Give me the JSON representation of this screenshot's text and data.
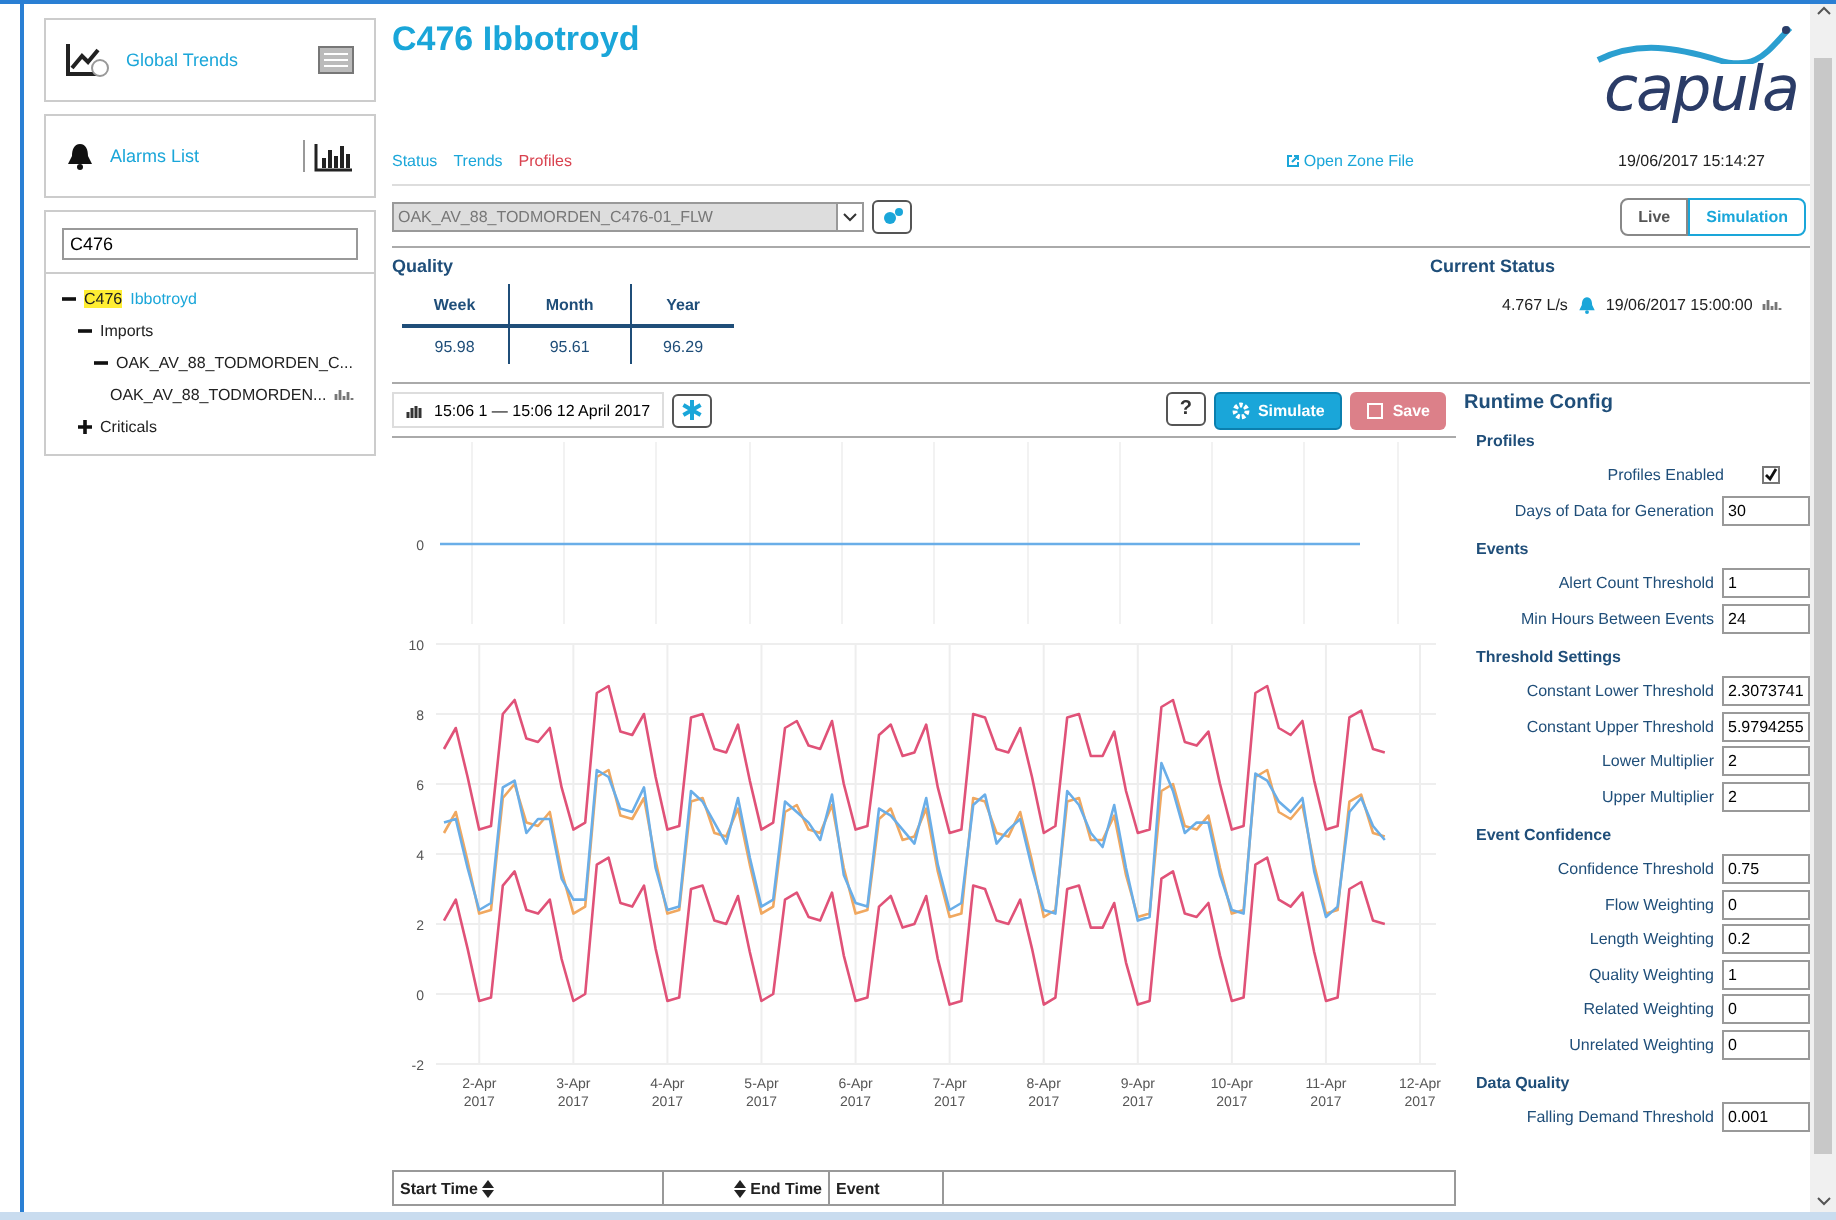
{
  "sidebar": {
    "cards": [
      {
        "kind": "trends",
        "label": "Global Trends"
      },
      {
        "kind": "alarms",
        "label": "Alarms List"
      }
    ],
    "search": {
      "value": "C476"
    },
    "tree": [
      {
        "kind": "site",
        "match": "C476",
        "label": "Ibbotroyd",
        "expanded": true,
        "children": [
          {
            "kind": "group",
            "label": "Imports",
            "expanded": true,
            "children": [
              {
                "kind": "group",
                "label": "OAK_AV_88_TODMORDEN_C...",
                "expanded": true,
                "children": [
                  {
                    "kind": "leaf",
                    "label": "OAK_AV_88_TODMORDEN..."
                  }
                ]
              }
            ]
          },
          {
            "kind": "group",
            "label": "Criticals",
            "expanded": false
          }
        ]
      }
    ]
  },
  "header": {
    "title": "C476 Ibbotroyd",
    "logo": "capula"
  },
  "nav": [
    {
      "label": "Status",
      "selected": false
    },
    {
      "label": "Trends",
      "selected": false
    },
    {
      "label": "Profiles",
      "selected": true
    }
  ],
  "open_zone_file": "Open Zone File",
  "timestamp": "19/06/2017 15:14:27",
  "meter_select": {
    "value": "OAK_AV_88_TODMORDEN_C476-01_FLW"
  },
  "mode": [
    {
      "label": "Live",
      "selected": false
    },
    {
      "label": "Simulation",
      "selected": true
    }
  ],
  "quality": {
    "title": "Quality",
    "columns": [
      "Week",
      "Month",
      "Year"
    ],
    "values": [
      "95.98",
      "95.61",
      "96.29"
    ]
  },
  "current_status": {
    "title": "Current Status",
    "reading": "4.767 L/s",
    "time": "19/06/2017 15:00:00"
  },
  "toolbar": {
    "date_range": "15:06 1 — 15:06 12 April 2017",
    "help": "?",
    "simulate": "Simulate",
    "save": {
      "label": "Save",
      "disabled": true
    }
  },
  "top_panel": {
    "tick": "0"
  },
  "chart": {
    "chart_data": {
      "type": "line",
      "grid": true,
      "ylim": [
        -2,
        10
      ],
      "yticks": [
        -2,
        0,
        2,
        4,
        6,
        8,
        10
      ],
      "categories": [
        null,
        null,
        null,
        "2-Apr 2017",
        null,
        null,
        null,
        null,
        null,
        null,
        null,
        "3-Apr 2017",
        null,
        null,
        null,
        null,
        null,
        null,
        null,
        "4-Apr 2017",
        null,
        null,
        null,
        null,
        null,
        null,
        null,
        "5-Apr 2017",
        null,
        null,
        null,
        null,
        null,
        null,
        null,
        "6-Apr 2017",
        null,
        null,
        null,
        null,
        null,
        null,
        null,
        "7-Apr 2017",
        null,
        null,
        null,
        null,
        null,
        null,
        null,
        "8-Apr 2017",
        null,
        null,
        null,
        null,
        null,
        null,
        null,
        "9-Apr 2017",
        null,
        null,
        null,
        null,
        null,
        null,
        null,
        "10-Apr 2017",
        null,
        null,
        null,
        null,
        null,
        null,
        null,
        "11-Apr 2017",
        null,
        null,
        null,
        null,
        null,
        null,
        null,
        "12-Apr 2017"
      ],
      "series": [
        {
          "color": "#e05278",
          "values": [
            7.0,
            7.6,
            6.2,
            4.7,
            4.8,
            8.0,
            8.4,
            7.3,
            7.2,
            7.6,
            5.9,
            4.7,
            4.9,
            8.6,
            8.8,
            7.5,
            7.4,
            8.0,
            6.2,
            4.7,
            4.8,
            7.9,
            8.0,
            7.0,
            6.9,
            7.7,
            6.1,
            4.7,
            4.9,
            7.6,
            7.8,
            7.1,
            7.0,
            7.8,
            6.0,
            4.7,
            4.8,
            7.4,
            7.7,
            6.8,
            6.9,
            7.7,
            5.9,
            4.6,
            4.7,
            8.0,
            7.9,
            7.0,
            6.9,
            7.6,
            6.2,
            4.6,
            4.8,
            7.9,
            8.0,
            6.8,
            6.8,
            7.5,
            5.8,
            4.6,
            4.7,
            8.2,
            8.4,
            7.2,
            7.1,
            7.5,
            6.0,
            4.7,
            4.8,
            8.6,
            8.8,
            7.6,
            7.4,
            7.8,
            6.1,
            4.7,
            4.8,
            7.9,
            8.1,
            7.0,
            6.9,
            null,
            null,
            null
          ]
        },
        {
          "color": "#e05278",
          "values": [
            2.1,
            2.7,
            1.3,
            -0.2,
            -0.1,
            3.1,
            3.5,
            2.4,
            2.3,
            2.7,
            1.0,
            -0.2,
            0.0,
            3.7,
            3.9,
            2.6,
            2.5,
            3.1,
            1.3,
            -0.2,
            -0.1,
            3.0,
            3.1,
            2.1,
            2.0,
            2.8,
            1.2,
            -0.2,
            0.0,
            2.7,
            2.9,
            2.2,
            2.1,
            2.9,
            1.1,
            -0.2,
            -0.1,
            2.5,
            2.8,
            1.9,
            2.0,
            2.8,
            1.0,
            -0.3,
            -0.2,
            3.1,
            3.0,
            2.1,
            2.0,
            2.7,
            1.3,
            -0.3,
            -0.1,
            3.0,
            3.1,
            1.9,
            1.9,
            2.6,
            0.9,
            -0.3,
            -0.2,
            3.3,
            3.5,
            2.3,
            2.2,
            2.6,
            1.1,
            -0.2,
            -0.1,
            3.7,
            3.9,
            2.7,
            2.5,
            2.9,
            1.2,
            -0.2,
            -0.1,
            3.0,
            3.2,
            2.1,
            2.0,
            null,
            null,
            null
          ]
        },
        {
          "color": "#f0a860",
          "values": [
            4.6,
            5.2,
            3.8,
            2.3,
            2.4,
            5.6,
            6.0,
            4.9,
            4.8,
            5.2,
            3.5,
            2.3,
            2.5,
            6.2,
            6.4,
            5.1,
            5.0,
            5.6,
            3.8,
            2.3,
            2.4,
            5.5,
            5.6,
            4.6,
            4.5,
            5.3,
            3.7,
            2.3,
            2.5,
            5.2,
            5.4,
            4.7,
            4.6,
            5.4,
            3.6,
            2.3,
            2.4,
            5.0,
            5.3,
            4.4,
            4.5,
            5.3,
            3.5,
            2.2,
            2.3,
            5.6,
            5.5,
            4.6,
            4.5,
            5.2,
            3.8,
            2.2,
            2.4,
            5.5,
            5.6,
            4.4,
            4.4,
            5.1,
            3.4,
            2.2,
            2.3,
            5.8,
            6.0,
            4.8,
            4.7,
            5.1,
            3.6,
            2.3,
            2.4,
            6.2,
            6.4,
            5.2,
            5.0,
            5.4,
            3.7,
            2.3,
            2.4,
            5.5,
            5.7,
            4.6,
            4.5,
            null,
            null,
            null
          ]
        },
        {
          "color": "#6aaee8",
          "values": [
            4.9,
            5.0,
            3.6,
            2.4,
            2.6,
            5.9,
            6.1,
            4.6,
            5.0,
            5.0,
            3.3,
            2.7,
            2.7,
            6.4,
            6.2,
            5.3,
            5.2,
            5.9,
            3.6,
            2.4,
            2.5,
            5.8,
            5.5,
            4.9,
            4.3,
            5.6,
            3.9,
            2.5,
            2.7,
            5.5,
            5.2,
            4.9,
            4.4,
            5.7,
            3.4,
            2.6,
            2.5,
            5.3,
            5.1,
            4.7,
            4.3,
            5.6,
            3.7,
            2.4,
            2.6,
            5.4,
            5.7,
            4.3,
            4.7,
            5.0,
            3.6,
            2.4,
            2.3,
            5.8,
            5.4,
            4.6,
            4.2,
            5.4,
            3.6,
            2.1,
            2.2,
            6.6,
            5.8,
            4.6,
            4.9,
            4.9,
            3.4,
            2.4,
            2.3,
            6.3,
            6.1,
            5.5,
            5.2,
            5.6,
            3.5,
            2.2,
            2.5,
            5.2,
            5.6,
            4.8,
            4.4,
            null,
            null,
            null
          ]
        }
      ]
    }
  },
  "events_table": {
    "columns": [
      "Start Time",
      "End Time",
      "Event"
    ]
  },
  "runtime_config": {
    "title": "Runtime Config",
    "sections": [
      {
        "title": "Profiles",
        "fields": [
          {
            "kind": "checkbox",
            "label": "Profiles Enabled",
            "checked": true
          },
          {
            "kind": "input",
            "label": "Days of Data for Generation",
            "value": "30"
          }
        ]
      },
      {
        "title": "Events",
        "fields": [
          {
            "kind": "input",
            "label": "Alert Count Threshold",
            "value": "1"
          },
          {
            "kind": "input",
            "label": "Min Hours Between Events",
            "value": "24"
          }
        ]
      },
      {
        "title": "Threshold Settings",
        "fields": [
          {
            "kind": "input",
            "label": "Constant Lower Threshold",
            "value": "2.3073741"
          },
          {
            "kind": "input",
            "label": "Constant Upper Threshold",
            "value": "5.9794255"
          },
          {
            "kind": "input",
            "label": "Lower Multiplier",
            "value": "2"
          },
          {
            "kind": "input",
            "label": "Upper Multiplier",
            "value": "2"
          }
        ]
      },
      {
        "title": "Event Confidence",
        "fields": [
          {
            "kind": "input",
            "label": "Confidence Threshold",
            "value": "0.75"
          },
          {
            "kind": "input",
            "label": "Flow Weighting",
            "value": "0"
          },
          {
            "kind": "input",
            "label": "Length Weighting",
            "value": "0.2"
          },
          {
            "kind": "input",
            "label": "Quality Weighting",
            "value": "1"
          },
          {
            "kind": "input",
            "label": "Related Weighting",
            "value": "0"
          },
          {
            "kind": "input",
            "label": "Unrelated Weighting",
            "value": "0"
          }
        ]
      },
      {
        "title": "Data Quality",
        "fields": [
          {
            "kind": "input",
            "label": "Falling Demand Threshold",
            "value": "0.001"
          }
        ]
      }
    ]
  }
}
